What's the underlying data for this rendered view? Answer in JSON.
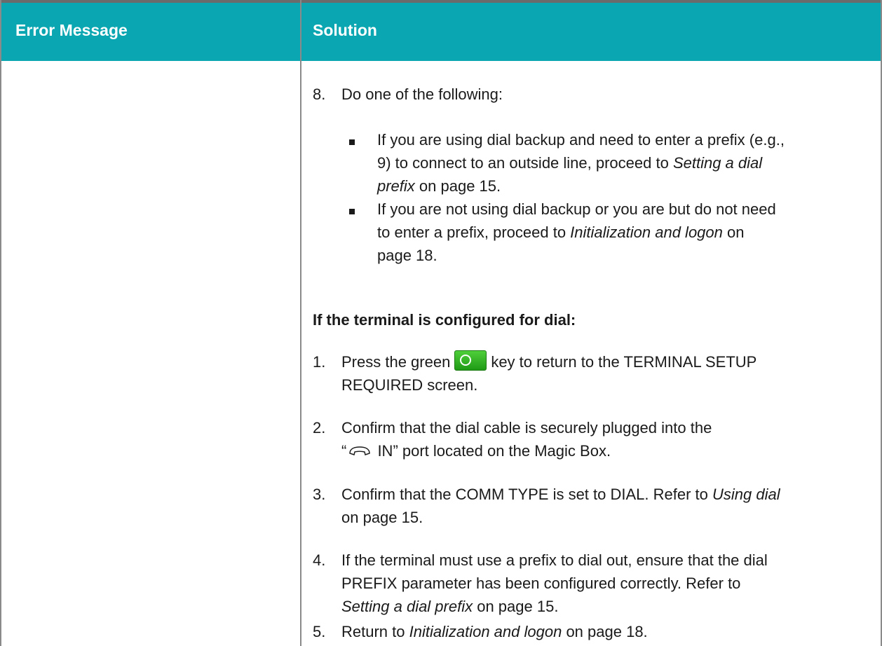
{
  "header": {
    "col1": "Error Message",
    "col2": "Solution"
  },
  "step8": {
    "num": "8.",
    "text": "Do one of the following:"
  },
  "bullets": [
    {
      "line1": "If you are using dial backup and need to enter a prefix (e.g.,",
      "line2_pre": "9) to connect to an outside line, proceed to ",
      "line2_italic": "Setting a dial",
      "line3_italic": "prefix",
      "line3_post": " on page 15."
    },
    {
      "line1": "If you are not using dial backup or you are but do not need",
      "line2_pre": "to enter a prefix, proceed to ",
      "line2_italic": "Initialization and logon",
      "line2_post": " on",
      "line3": "page 18."
    }
  ],
  "dial_heading": "If the terminal is configured for dial:",
  "steps": [
    {
      "num": "1.",
      "line1_pre": "Press the green",
      "line1_post": "key to return to the TERMINAL SETUP",
      "line2": "REQUIRED screen."
    },
    {
      "num": "2.",
      "line1": "Confirm that the dial cable is securely plugged into the",
      "line2_open_quote": "“",
      "line2_post": " IN” port located on the Magic Box."
    },
    {
      "num": "3.",
      "line1_pre": "Confirm that the COMM TYPE is set to DIAL. Refer to ",
      "line1_italic": "Using dial",
      "line2": "on page 15."
    },
    {
      "num": "4.",
      "line1": "If the terminal must use a prefix to dial out, ensure that the dial",
      "line2": "PREFIX parameter has been configured correctly. Refer to",
      "line3_italic": "Setting a dial prefix",
      "line3_post": " on page 15."
    },
    {
      "num": "5.",
      "line1_pre": "Return to ",
      "line1_italic": "Initialization and logon",
      "line1_post": " on page 18."
    }
  ],
  "icons": [
    "green-key-icon",
    "phone-handset-icon"
  ],
  "colors": {
    "header_bg": "#0aa6b1",
    "header_text": "#ffffff",
    "key_green": "#2db323"
  }
}
